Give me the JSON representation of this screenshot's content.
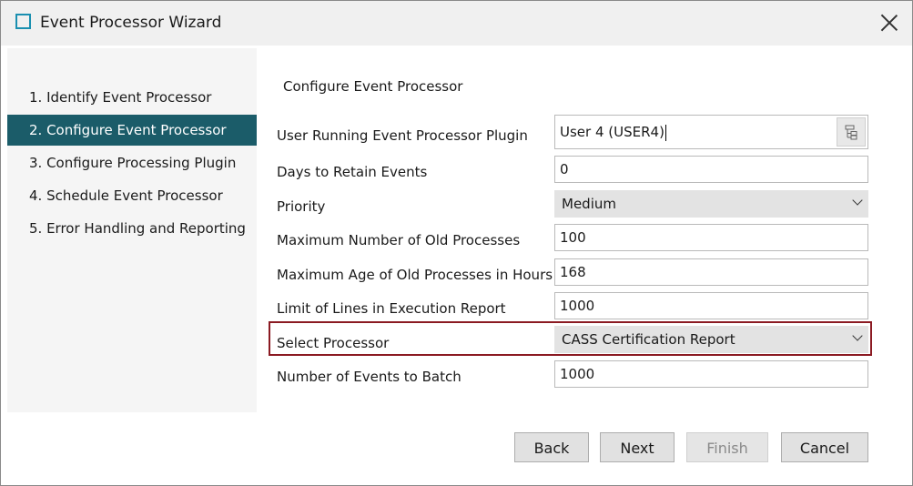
{
  "window": {
    "title": "Event Processor Wizard"
  },
  "steps": [
    {
      "label": "1. Identify Event Processor"
    },
    {
      "label": "2. Configure Event Processor"
    },
    {
      "label": "3. Configure Processing Plugin"
    },
    {
      "label": "4. Schedule Event Processor"
    },
    {
      "label": "5. Error Handling and Reporting"
    }
  ],
  "form": {
    "section_title": "Configure Event Processor",
    "user_label": "User Running Event Processor Plugin",
    "user_value": "User 4 (USER4)",
    "days_label": "Days to Retain Events",
    "days_value": "0",
    "priority_label": "Priority",
    "priority_value": "Medium",
    "max_old_label": "Maximum Number of Old Processes",
    "max_old_value": "100",
    "max_age_label": "Maximum Age of Old Processes in Hours",
    "max_age_value": "168",
    "limit_label": "Limit of Lines in Execution Report",
    "limit_value": "1000",
    "select_label": "Select Processor",
    "select_value": "CASS Certification Report",
    "batch_label": "Number of Events to Batch",
    "batch_value": "1000"
  },
  "buttons": {
    "back": "Back",
    "next": "Next",
    "finish": "Finish",
    "cancel": "Cancel"
  },
  "colors": {
    "active_step": "#1b5c69",
    "highlight": "#8b1a22",
    "app_icon": "#1a8fb0"
  }
}
